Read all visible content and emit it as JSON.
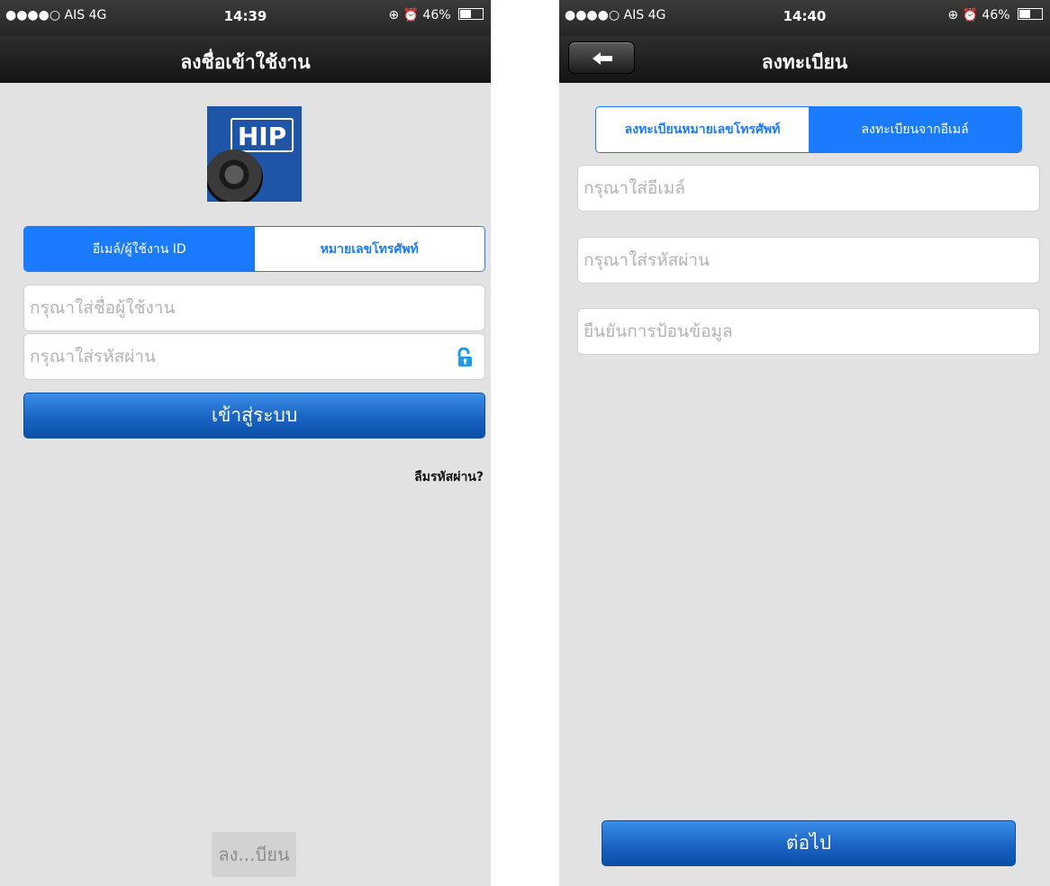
{
  "left_screen": {
    "status": {
      "carrier": "●●●●○ AIS  4G",
      "time": "14:39",
      "right": "⊕ ⏰ 46%",
      "battery_level": 0.46
    },
    "title": "ลงชื่อเข้าใช้งาน",
    "logo_text": "HIP",
    "tabs": [
      {
        "label": "อีเมล์/ผู้ใช้งาน ID",
        "active": true
      },
      {
        "label": "หมายเลขโทรศัพท์",
        "active": false
      }
    ],
    "username_placeholder": "กรุณาใส่ชื่อผู้ใช้งาน",
    "password_placeholder": "กรุณาใส่รหัสผ่าน",
    "login_label": "เข้าสู่ระบบ",
    "forgot_label": "ลืมรหัสผ่าน?",
    "register_label": "ลง...บียน"
  },
  "right_screen": {
    "status": {
      "carrier": "●●●●○ AIS  4G",
      "time": "14:40",
      "right": "⊕ ⏰ 46%",
      "battery_level": 0.46
    },
    "title": "ลงทะเบียน",
    "tabs": [
      {
        "label": "ลงทะเบียนหมายเลขโทรศัพท์",
        "active": false
      },
      {
        "label": "ลงทะเบียนจากอีเมล์",
        "active": true
      }
    ],
    "email_placeholder": "กรุณาใส่อีเมล์",
    "password_placeholder": "กรุณาใส่รหัสผ่าน",
    "confirm_placeholder": "ยืนยันการป้อนข้อมูล",
    "next_label": "ต่อไป"
  },
  "colors": {
    "accent": "#1a7bff",
    "button_blue": "#1a64c4",
    "background": "#e2e2e2",
    "navbar": "#1c1c1c"
  },
  "icons": [
    "back-arrow-icon",
    "lock-open-icon",
    "battery-icon",
    "camera-lens-icon"
  ]
}
